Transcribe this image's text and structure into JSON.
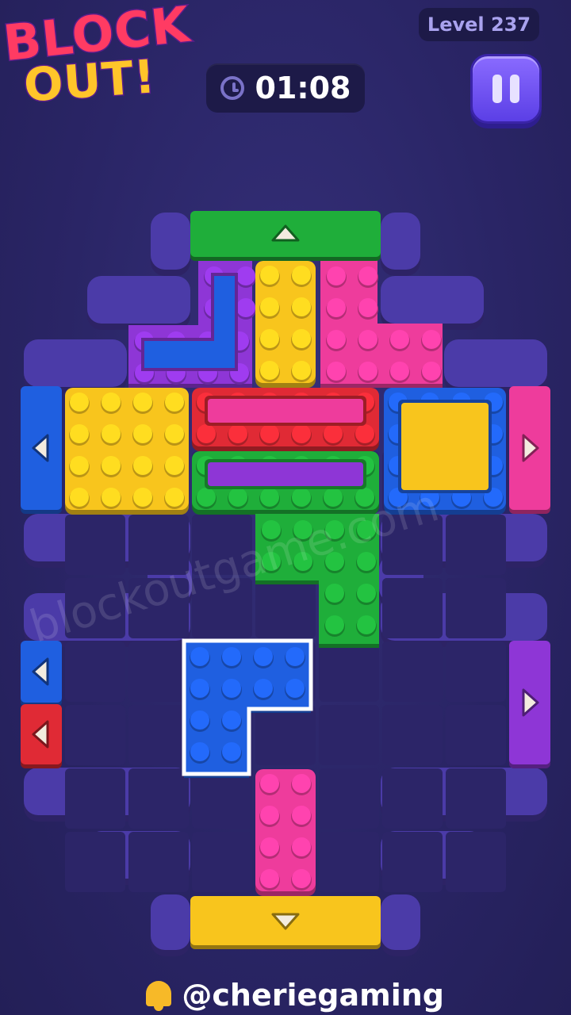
{
  "logo": {
    "line1": "BLOCK",
    "line2": "OUT!"
  },
  "level": {
    "label": "Level 237"
  },
  "timer": {
    "value": "01:08"
  },
  "watermark": "blockoutgame.com",
  "credit": {
    "handle": "@cheriegaming"
  },
  "colors": {
    "background": "#2a2566",
    "board_wall": "#4b3ba8",
    "cell": "#2c2568",
    "red": "#e02a35",
    "yellow": "#f8c51d",
    "pink": "#ee3c9c",
    "purple": "#8e36d6",
    "blue": "#1f5fe0",
    "green": "#1fae3a"
  },
  "board": {
    "columns": 9,
    "rows": 11,
    "exits": [
      {
        "name": "exit-top-green",
        "color": "green",
        "direction": "up"
      },
      {
        "name": "exit-bottom-yellow",
        "color": "yellow",
        "direction": "down"
      },
      {
        "name": "exit-left-blue-upper",
        "color": "blue",
        "direction": "left"
      },
      {
        "name": "exit-right-pink",
        "color": "pink",
        "direction": "right"
      },
      {
        "name": "exit-left-blue-lower",
        "color": "blue",
        "direction": "left"
      },
      {
        "name": "exit-left-red",
        "color": "red",
        "direction": "left"
      },
      {
        "name": "exit-right-purple",
        "color": "purple",
        "direction": "right"
      }
    ],
    "blocks": [
      {
        "name": "block-purple-l",
        "color": "purple",
        "inner": "blue",
        "selected": false
      },
      {
        "name": "block-yellow-vertical",
        "color": "yellow",
        "selected": false
      },
      {
        "name": "block-pink-t",
        "color": "pink",
        "selected": false
      },
      {
        "name": "block-yellow-square",
        "color": "yellow",
        "selected": false
      },
      {
        "name": "block-red-bar",
        "color": "red",
        "inner": "pink",
        "selected": false
      },
      {
        "name": "block-green-bar",
        "color": "green",
        "inner": "purple",
        "selected": false
      },
      {
        "name": "block-blue-frame",
        "color": "blue",
        "inner": "yellow",
        "selected": false
      },
      {
        "name": "block-green-shape",
        "color": "green",
        "selected": false
      },
      {
        "name": "block-blue-l",
        "color": "blue",
        "selected": true
      },
      {
        "name": "block-pink-vertical",
        "color": "pink",
        "selected": false
      }
    ]
  }
}
